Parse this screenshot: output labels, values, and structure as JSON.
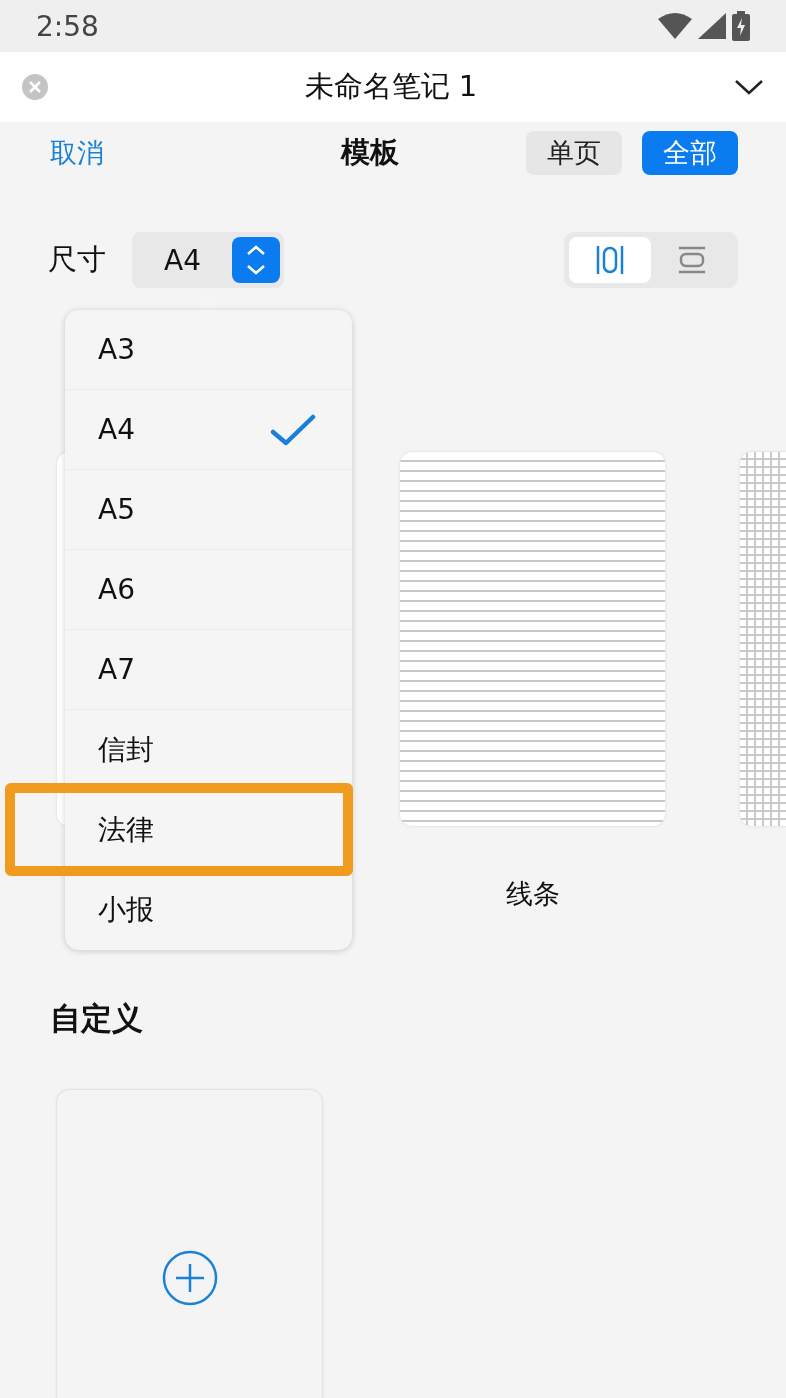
{
  "status_bar": {
    "time": "2:58"
  },
  "header": {
    "title": "未命名笔记 1"
  },
  "toolbar": {
    "cancel": "取消",
    "title": "模板",
    "modes": [
      {
        "label": "单页",
        "selected": false
      },
      {
        "label": "全部",
        "selected": true
      }
    ]
  },
  "size": {
    "label": "尺寸",
    "value": "A4"
  },
  "orientation": [
    {
      "kind": "portrait",
      "selected": true
    },
    {
      "kind": "landscape",
      "selected": false
    }
  ],
  "templates": [
    {
      "kind": "blank"
    },
    {
      "kind": "lines",
      "label": "线条"
    },
    {
      "kind": "grid"
    }
  ],
  "custom": {
    "heading": "自定义"
  },
  "size_menu": [
    {
      "label": "A3",
      "selected": false,
      "highlighted": false
    },
    {
      "label": "A4",
      "selected": true,
      "highlighted": false
    },
    {
      "label": "A5",
      "selected": false,
      "highlighted": false
    },
    {
      "label": "A6",
      "selected": false,
      "highlighted": false
    },
    {
      "label": "A7",
      "selected": false,
      "highlighted": false
    },
    {
      "label": "信封",
      "selected": false,
      "highlighted": false
    },
    {
      "label": "法律",
      "selected": false,
      "highlighted": true
    },
    {
      "label": "小报",
      "selected": false,
      "highlighted": false
    }
  ]
}
